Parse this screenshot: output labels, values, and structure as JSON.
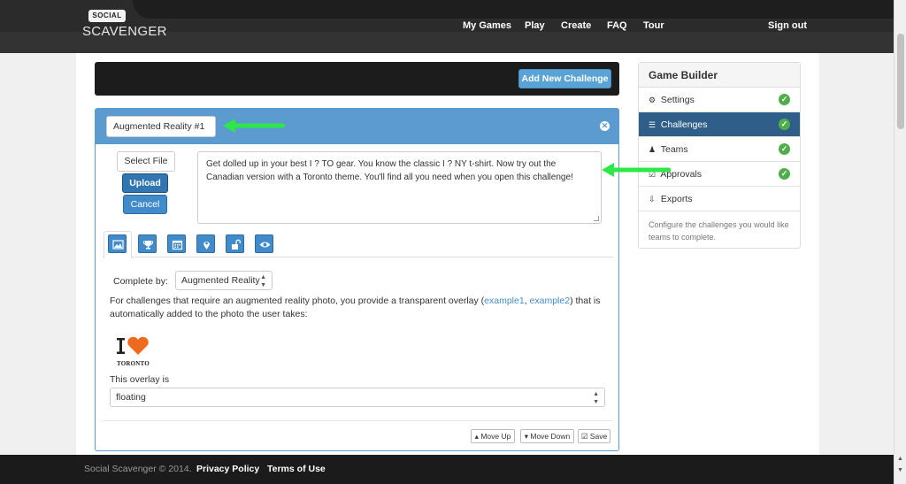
{
  "brand": {
    "badge": "SOCIAL",
    "name": "SCAVENGER"
  },
  "nav": {
    "items": [
      "My Games",
      "Play",
      "Create",
      "FAQ",
      "Tour"
    ],
    "sign_out": "Sign out"
  },
  "toolbar": {
    "add_label": "Add New Challenge"
  },
  "challenge": {
    "name": "Augmented Reality #1",
    "select_file_label": "Select File",
    "upload_label": "Upload",
    "cancel_label": "Cancel",
    "description": "Get dolled up in your best I ?  TO gear. You know the classic I ?  NY t-shirt. Now try out the Canadian version with a Toronto theme. You'll find all you need when you open this challenge!",
    "tabs": [
      {
        "icon": "image-icon"
      },
      {
        "icon": "trophy-icon"
      },
      {
        "icon": "calendar-icon"
      },
      {
        "icon": "map-marker-icon"
      },
      {
        "icon": "unlock-icon"
      },
      {
        "icon": "eye-icon"
      }
    ],
    "complete_by_label": "Complete by:",
    "complete_by_value": "Augmented Reality",
    "info_text_1": "For challenges that require an augmented reality photo, you provide a transparent overlay (",
    "example1": "example1",
    "info_sep": ", ",
    "example2": "example2",
    "info_text_2": ") that is automatically added to the photo the user takes:",
    "overlay_caption": "TORONTO",
    "overlay_label": "This overlay is",
    "overlay_value": "floating",
    "move_up_label": "Move Up",
    "move_down_label": "Move Down",
    "save_label": "Save"
  },
  "game_builder": {
    "title": "Game Builder",
    "items": [
      {
        "label": "Settings",
        "glyph": "⚙"
      },
      {
        "label": "Challenges",
        "glyph": "☰"
      },
      {
        "label": "Teams",
        "glyph": "♟"
      },
      {
        "label": "Approvals",
        "glyph": "☑"
      },
      {
        "label": "Exports",
        "glyph": "⇩"
      }
    ],
    "note": "Configure the challenges you would like teams to complete."
  },
  "footer": {
    "copyright": "Social Scavenger © 2014.",
    "privacy": "Privacy Policy",
    "terms": "Terms of Use"
  },
  "colors": {
    "accent": "#428bca",
    "panel_header": "#5b9bd0",
    "active_item": "#2f5f88",
    "success": "#4fae4a",
    "annotation_arrow": "#2ee84a"
  }
}
